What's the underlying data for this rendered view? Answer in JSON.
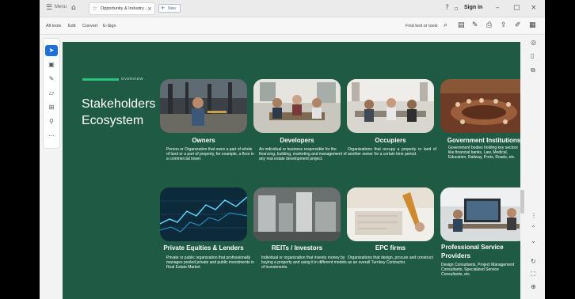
{
  "browser": {
    "menu_label": "Menu",
    "tab_title": "Opportunity & Industry ...",
    "new_tab_label": "New",
    "sign_in": "Sign in"
  },
  "menubar": {
    "items": [
      "All tools",
      "Edit",
      "Convert",
      "E-Sign"
    ],
    "find_text": "Find text or tools"
  },
  "slide": {
    "overline": "OVERVIEW",
    "title": "Stakeholders Ecosystem",
    "cards": [
      {
        "title": "Owners",
        "desc": "Person or Organization that owns a part of whole of land or a part of property, for example, a floor in a commercial tower."
      },
      {
        "title": "Developers",
        "desc": "An individual or business responsible for the financing, building, marketing and management of any real estate development project."
      },
      {
        "title": "Occupiers",
        "desc": "Organizations that occupy a property or land of another owner for a certain time period."
      },
      {
        "title": "Government Institutions",
        "desc": "Government bodies holding key sectors like financial banks, Law, Medical, Education, Railway, Ports, Roads, etc."
      },
      {
        "title": "Private Equities & Lenders",
        "desc": "Private or public organization that professionally manages pooled private and public investments in Real Estate Market."
      },
      {
        "title": "REITs / Investors",
        "desc": "Individual or organization that invests money by buying a property and using it in different models of investments."
      },
      {
        "title": "EPC firms",
        "desc": "Organizations that design, procure and construct as an overall Turnkey Contractor."
      },
      {
        "title": "Professional Service Providers",
        "desc": "Design Consultants, Project Management Consultants, Specialized Service Consultants, etc."
      }
    ]
  },
  "colors": {
    "slide_bg": "#1f5a45",
    "accent": "#2ec27e",
    "active_tool": "#1e6fd9"
  }
}
